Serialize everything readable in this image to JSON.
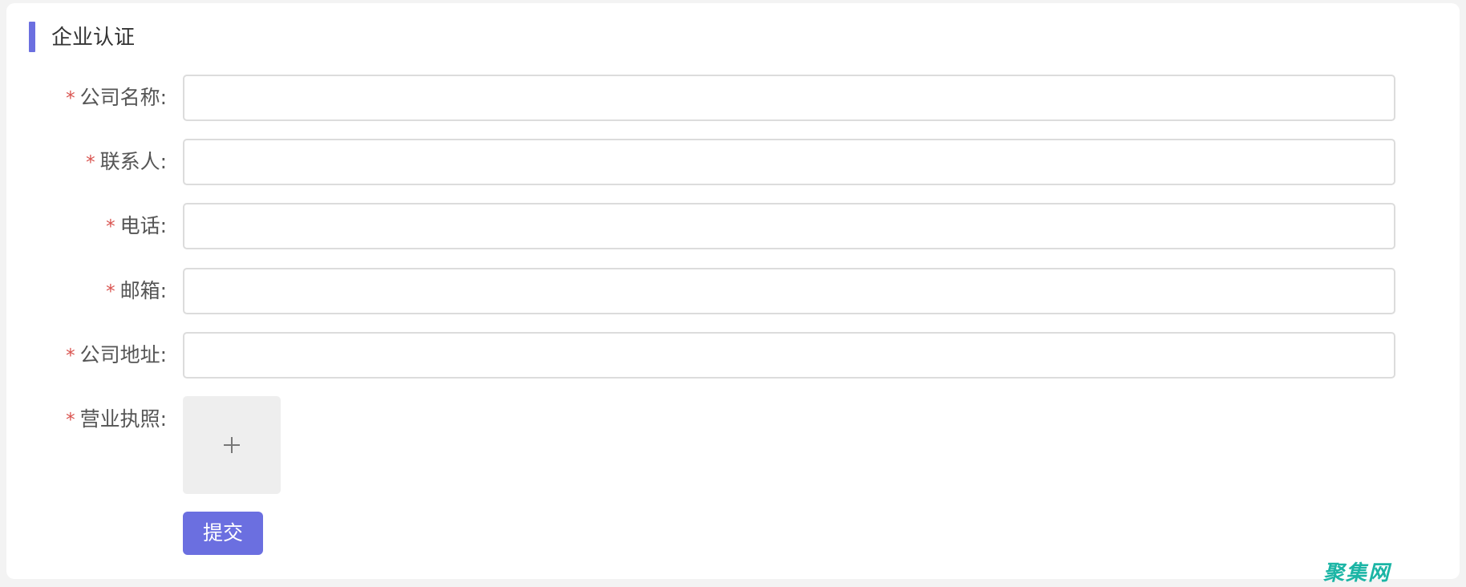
{
  "section": {
    "title": "企业认证"
  },
  "form": {
    "required_mark": "*",
    "fields": [
      {
        "label": "公司名称:",
        "value": "",
        "placeholder": ""
      },
      {
        "label": "联系人:",
        "value": "",
        "placeholder": ""
      },
      {
        "label": "电话:",
        "value": "",
        "placeholder": ""
      },
      {
        "label": "邮箱:",
        "value": "",
        "placeholder": ""
      },
      {
        "label": "公司地址:",
        "value": "",
        "placeholder": ""
      }
    ],
    "upload": {
      "label": "营业执照:",
      "icon": "plus-icon"
    },
    "submit_label": "提交"
  },
  "watermark": {
    "text": "聚集网"
  },
  "colors": {
    "accent": "#6b6fe0",
    "required": "#d9534f",
    "watermark": "#1bb5a5"
  }
}
